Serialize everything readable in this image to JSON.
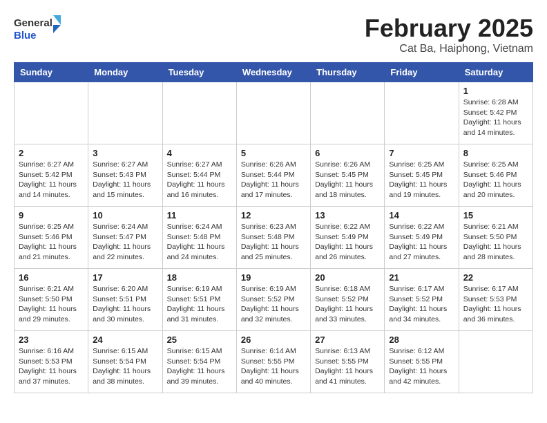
{
  "header": {
    "logo_general": "General",
    "logo_blue": "Blue",
    "month_title": "February 2025",
    "location": "Cat Ba, Haiphong, Vietnam"
  },
  "days_of_week": [
    "Sunday",
    "Monday",
    "Tuesday",
    "Wednesday",
    "Thursday",
    "Friday",
    "Saturday"
  ],
  "weeks": [
    [
      {
        "day": "",
        "info": ""
      },
      {
        "day": "",
        "info": ""
      },
      {
        "day": "",
        "info": ""
      },
      {
        "day": "",
        "info": ""
      },
      {
        "day": "",
        "info": ""
      },
      {
        "day": "",
        "info": ""
      },
      {
        "day": "1",
        "info": "Sunrise: 6:28 AM\nSunset: 5:42 PM\nDaylight: 11 hours and 14 minutes."
      }
    ],
    [
      {
        "day": "2",
        "info": "Sunrise: 6:27 AM\nSunset: 5:42 PM\nDaylight: 11 hours and 14 minutes."
      },
      {
        "day": "3",
        "info": "Sunrise: 6:27 AM\nSunset: 5:43 PM\nDaylight: 11 hours and 15 minutes."
      },
      {
        "day": "4",
        "info": "Sunrise: 6:27 AM\nSunset: 5:44 PM\nDaylight: 11 hours and 16 minutes."
      },
      {
        "day": "5",
        "info": "Sunrise: 6:26 AM\nSunset: 5:44 PM\nDaylight: 11 hours and 17 minutes."
      },
      {
        "day": "6",
        "info": "Sunrise: 6:26 AM\nSunset: 5:45 PM\nDaylight: 11 hours and 18 minutes."
      },
      {
        "day": "7",
        "info": "Sunrise: 6:25 AM\nSunset: 5:45 PM\nDaylight: 11 hours and 19 minutes."
      },
      {
        "day": "8",
        "info": "Sunrise: 6:25 AM\nSunset: 5:46 PM\nDaylight: 11 hours and 20 minutes."
      }
    ],
    [
      {
        "day": "9",
        "info": "Sunrise: 6:25 AM\nSunset: 5:46 PM\nDaylight: 11 hours and 21 minutes."
      },
      {
        "day": "10",
        "info": "Sunrise: 6:24 AM\nSunset: 5:47 PM\nDaylight: 11 hours and 22 minutes."
      },
      {
        "day": "11",
        "info": "Sunrise: 6:24 AM\nSunset: 5:48 PM\nDaylight: 11 hours and 24 minutes."
      },
      {
        "day": "12",
        "info": "Sunrise: 6:23 AM\nSunset: 5:48 PM\nDaylight: 11 hours and 25 minutes."
      },
      {
        "day": "13",
        "info": "Sunrise: 6:22 AM\nSunset: 5:49 PM\nDaylight: 11 hours and 26 minutes."
      },
      {
        "day": "14",
        "info": "Sunrise: 6:22 AM\nSunset: 5:49 PM\nDaylight: 11 hours and 27 minutes."
      },
      {
        "day": "15",
        "info": "Sunrise: 6:21 AM\nSunset: 5:50 PM\nDaylight: 11 hours and 28 minutes."
      }
    ],
    [
      {
        "day": "16",
        "info": "Sunrise: 6:21 AM\nSunset: 5:50 PM\nDaylight: 11 hours and 29 minutes."
      },
      {
        "day": "17",
        "info": "Sunrise: 6:20 AM\nSunset: 5:51 PM\nDaylight: 11 hours and 30 minutes."
      },
      {
        "day": "18",
        "info": "Sunrise: 6:19 AM\nSunset: 5:51 PM\nDaylight: 11 hours and 31 minutes."
      },
      {
        "day": "19",
        "info": "Sunrise: 6:19 AM\nSunset: 5:52 PM\nDaylight: 11 hours and 32 minutes."
      },
      {
        "day": "20",
        "info": "Sunrise: 6:18 AM\nSunset: 5:52 PM\nDaylight: 11 hours and 33 minutes."
      },
      {
        "day": "21",
        "info": "Sunrise: 6:17 AM\nSunset: 5:52 PM\nDaylight: 11 hours and 34 minutes."
      },
      {
        "day": "22",
        "info": "Sunrise: 6:17 AM\nSunset: 5:53 PM\nDaylight: 11 hours and 36 minutes."
      }
    ],
    [
      {
        "day": "23",
        "info": "Sunrise: 6:16 AM\nSunset: 5:53 PM\nDaylight: 11 hours and 37 minutes."
      },
      {
        "day": "24",
        "info": "Sunrise: 6:15 AM\nSunset: 5:54 PM\nDaylight: 11 hours and 38 minutes."
      },
      {
        "day": "25",
        "info": "Sunrise: 6:15 AM\nSunset: 5:54 PM\nDaylight: 11 hours and 39 minutes."
      },
      {
        "day": "26",
        "info": "Sunrise: 6:14 AM\nSunset: 5:55 PM\nDaylight: 11 hours and 40 minutes."
      },
      {
        "day": "27",
        "info": "Sunrise: 6:13 AM\nSunset: 5:55 PM\nDaylight: 11 hours and 41 minutes."
      },
      {
        "day": "28",
        "info": "Sunrise: 6:12 AM\nSunset: 5:55 PM\nDaylight: 11 hours and 42 minutes."
      },
      {
        "day": "",
        "info": ""
      }
    ]
  ]
}
